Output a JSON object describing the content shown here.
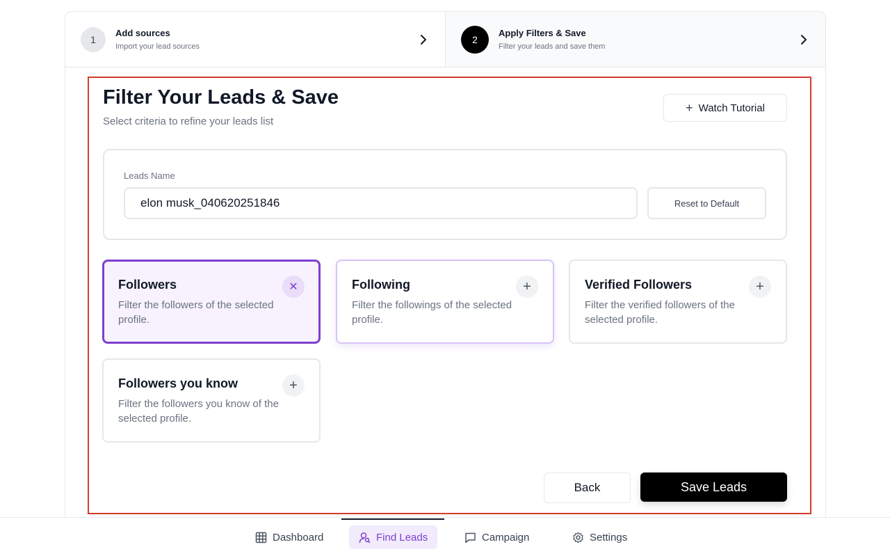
{
  "stepper": {
    "steps": [
      {
        "number": "1",
        "title": "Add sources",
        "subtitle": "Import your lead sources"
      },
      {
        "number": "2",
        "title": "Apply Filters & Save",
        "subtitle": "Filter your leads and save them"
      }
    ]
  },
  "header": {
    "title": "Filter Your Leads & Save",
    "subtitle": "Select criteria to refine your leads list",
    "tutorial_label": "Watch Tutorial"
  },
  "leads_name": {
    "label": "Leads Name",
    "value": "elon musk_040620251846",
    "reset_label": "Reset to Default"
  },
  "filters": [
    {
      "title": "Followers",
      "description": "Filter the followers of the selected profile.",
      "selected": true
    },
    {
      "title": "Following",
      "description": "Filter the followings of the selected profile.",
      "selected": false
    },
    {
      "title": "Verified Followers",
      "description": "Filter the verified followers of the selected profile.",
      "selected": false
    },
    {
      "title": "Followers you know",
      "description": "Filter the followers you know of the selected profile.",
      "selected": false
    }
  ],
  "actions": {
    "back_label": "Back",
    "save_label": "Save Leads"
  },
  "nav": {
    "items": [
      {
        "label": "Dashboard",
        "icon": "grid-icon"
      },
      {
        "label": "Find Leads",
        "icon": "user-search-icon",
        "active": true
      },
      {
        "label": "Campaign",
        "icon": "message-icon"
      },
      {
        "label": "Settings",
        "icon": "gear-icon"
      }
    ]
  },
  "colors": {
    "accent": "#7e3fd0",
    "frame_highlight": "#d43b2e",
    "primary_button": "#000000"
  }
}
